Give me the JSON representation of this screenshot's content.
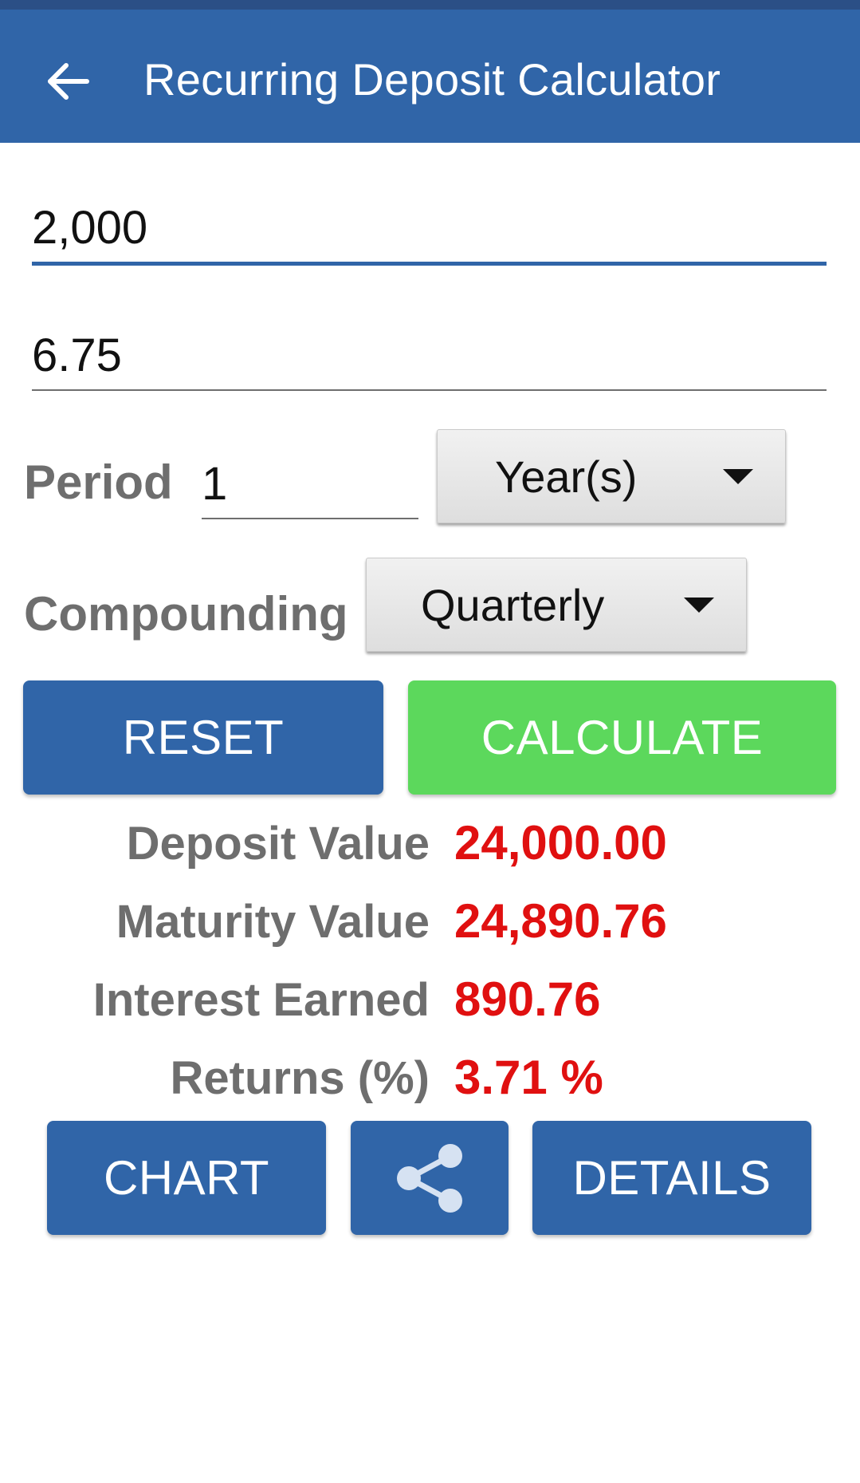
{
  "app_bar": {
    "title": "Recurring Deposit Calculator",
    "back_icon": "arrow-left-icon",
    "color": "#3065a8"
  },
  "inputs": {
    "deposit_amount": "2,000",
    "interest_rate": "6.75"
  },
  "period": {
    "label": "Period",
    "value": "1",
    "unit_selected": "Year(s)"
  },
  "compounding": {
    "label": "Compounding",
    "selected": "Quarterly"
  },
  "actions": {
    "reset_label": "RESET",
    "calculate_label": "CALCULATE",
    "chart_label": "CHART",
    "share_icon": "share-icon",
    "details_label": "DETAILS"
  },
  "results": {
    "deposit_value_label": "Deposit Value",
    "deposit_value": "24,000.00",
    "maturity_value_label": "Maturity Value",
    "maturity_value": "24,890.76",
    "interest_earned_label": "Interest Earned",
    "interest_earned": "890.76",
    "returns_label": "Returns (%)",
    "returns": "3.71 %"
  },
  "colors": {
    "primary": "#3065a8",
    "accent_green": "#5cd85c",
    "result_red": "#e01010",
    "label_grey": "#6e6e6e"
  }
}
